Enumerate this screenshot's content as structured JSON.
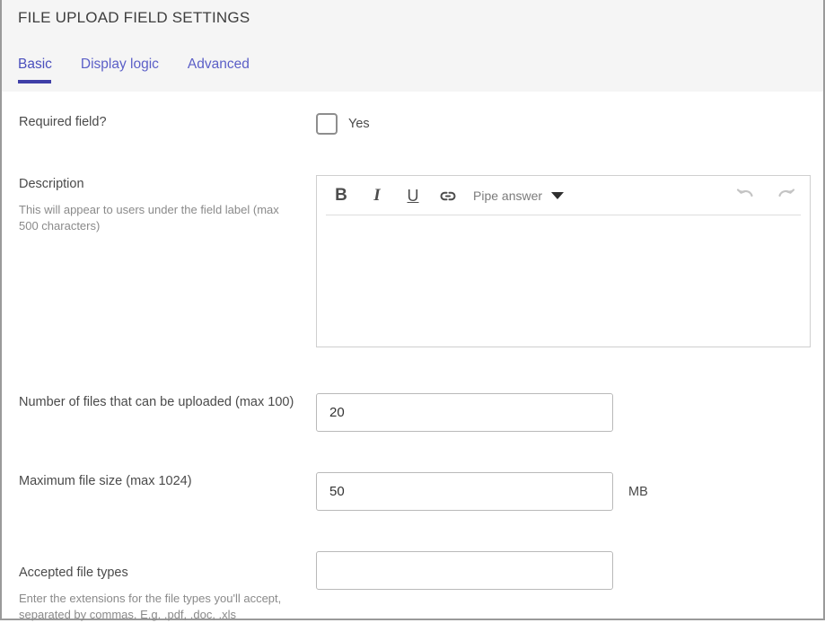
{
  "header": {
    "title": "FILE UPLOAD FIELD SETTINGS",
    "accent_color": "#3f3fa8",
    "tab_color": "#5b5fc7",
    "background": "#f5f5f5",
    "tabs": [
      {
        "label": "Basic",
        "active": true
      },
      {
        "label": "Display logic",
        "active": false
      },
      {
        "label": "Advanced",
        "active": false
      }
    ]
  },
  "form": {
    "required_field": {
      "label": "Required field?",
      "checkbox_label": "Yes",
      "checked": false
    },
    "description": {
      "label": "Description",
      "hint": "This will appear to users under the field label (max 500 characters)",
      "value": "",
      "toolbar": {
        "bold": "B",
        "italic": "I",
        "underline": "U",
        "link_icon": "link-icon",
        "pipe_answer": "Pipe answer",
        "undo_icon": "undo-icon",
        "redo_icon": "redo-icon"
      }
    },
    "number_of_files": {
      "label": "Number of files that can be uploaded (max 100)",
      "value": "20"
    },
    "maximum_file_size": {
      "label": "Maximum file size (max 1024)",
      "value": "50",
      "unit": "MB"
    },
    "accepted_file_types": {
      "label": "Accepted file types",
      "hint": "Enter the extensions for the file types you'll accept, separated by commas. E.g. .pdf, .doc, .xls",
      "value": "",
      "placeholder": ""
    }
  }
}
